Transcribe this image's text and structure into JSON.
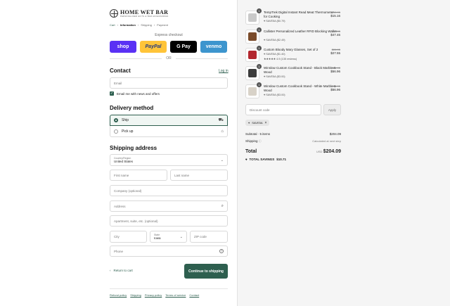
{
  "brand": {
    "name": "HOME WET BAR",
    "tagline": "PERSONALIZED GIFTS & BAR ACCESSORIES"
  },
  "breadcrumb": [
    "Cart",
    "Information",
    "Shipping",
    "Payment"
  ],
  "express": {
    "label": "Express checkout",
    "buttons": [
      {
        "label": "shop",
        "bg": "#5a31f4",
        "color": "#ffffff"
      },
      {
        "label": "PayPal",
        "bg": "#ffc439",
        "color": "#253b80"
      },
      {
        "label": "G Pay",
        "bg": "#000000",
        "color": "#ffffff"
      },
      {
        "label": "venmo",
        "bg": "#3d95ce",
        "color": "#ffffff"
      }
    ],
    "or": "OR"
  },
  "contact": {
    "heading": "Contact",
    "login": "Log in",
    "email_placeholder": "Email",
    "newsletter": "Email me with news and offers"
  },
  "delivery": {
    "heading": "Delivery method",
    "ship": "Ship",
    "pickup": "Pick up"
  },
  "shipping": {
    "heading": "Shipping address",
    "country_label": "Country/Region",
    "country_value": "United States",
    "first_name": "First name",
    "last_name": "Last name",
    "company": "Company (optional)",
    "address": "Address",
    "apartment": "Apartment, suite, etc. (optional)",
    "city": "City",
    "state_label": "State",
    "state_value": "Iowa",
    "zip": "ZIP code",
    "phone": "Phone"
  },
  "actions": {
    "return": "Return to cart",
    "continue": "Continue to shipping"
  },
  "footer": [
    "Refund policy",
    "Shipping",
    "Privacy policy",
    "Terms of service",
    "Contact"
  ],
  "order": {
    "items": [
      {
        "qty": "1",
        "name": "TempTrek Digital Instant Read Meat Thermometer for Cooking",
        "discount": "SAVE5A ($0.79)",
        "old_price": "$15.95",
        "price": "$15.16",
        "swatch": "#c9c9c9"
      },
      {
        "qty": "1",
        "name": "Callister Personalized Leather RFID Blocking Wallet",
        "discount": "SAVE5A ($2.49)",
        "old_price": "$49.95",
        "price": "$47.46",
        "swatch": "#7a4b2a"
      },
      {
        "qty": "1",
        "name": "Custom Bloody Mary Glasses, Set of 2",
        "discount": "SAVE5A ($1.40)",
        "rating": "★★★★★ 4.9 (135 reviews)",
        "old_price": "$28.95",
        "price": "$27.55",
        "swatch": "#b3262e"
      },
      {
        "qty": "1",
        "name": "Winslow Custom Cookbook Stand - Black Marble & Wood",
        "discount": "SAVE5A ($3.00)",
        "old_price": "$59.95",
        "price": "$56.96",
        "swatch": "#3b3b3b"
      },
      {
        "qty": "1",
        "name": "Winslow Custom Cookbook Stand - White Marble & Wood",
        "discount": "SAVE5A ($3.00)",
        "old_price": "$59.95",
        "price": "$56.96",
        "swatch": "#d8d2c8"
      }
    ],
    "discount_placeholder": "Discount code",
    "apply": "Apply",
    "applied_code": "SAVE5A",
    "subtotal_label": "Subtotal · 5 items",
    "subtotal": "$204.09",
    "shipping_label": "Shipping",
    "shipping_value": "Calculated at next step",
    "total_label": "Total",
    "currency": "USD",
    "total": "$204.09",
    "savings_label": "TOTAL SAVINGS",
    "savings": "$10.71"
  },
  "colors": {
    "accent": "#2e5f4f"
  }
}
